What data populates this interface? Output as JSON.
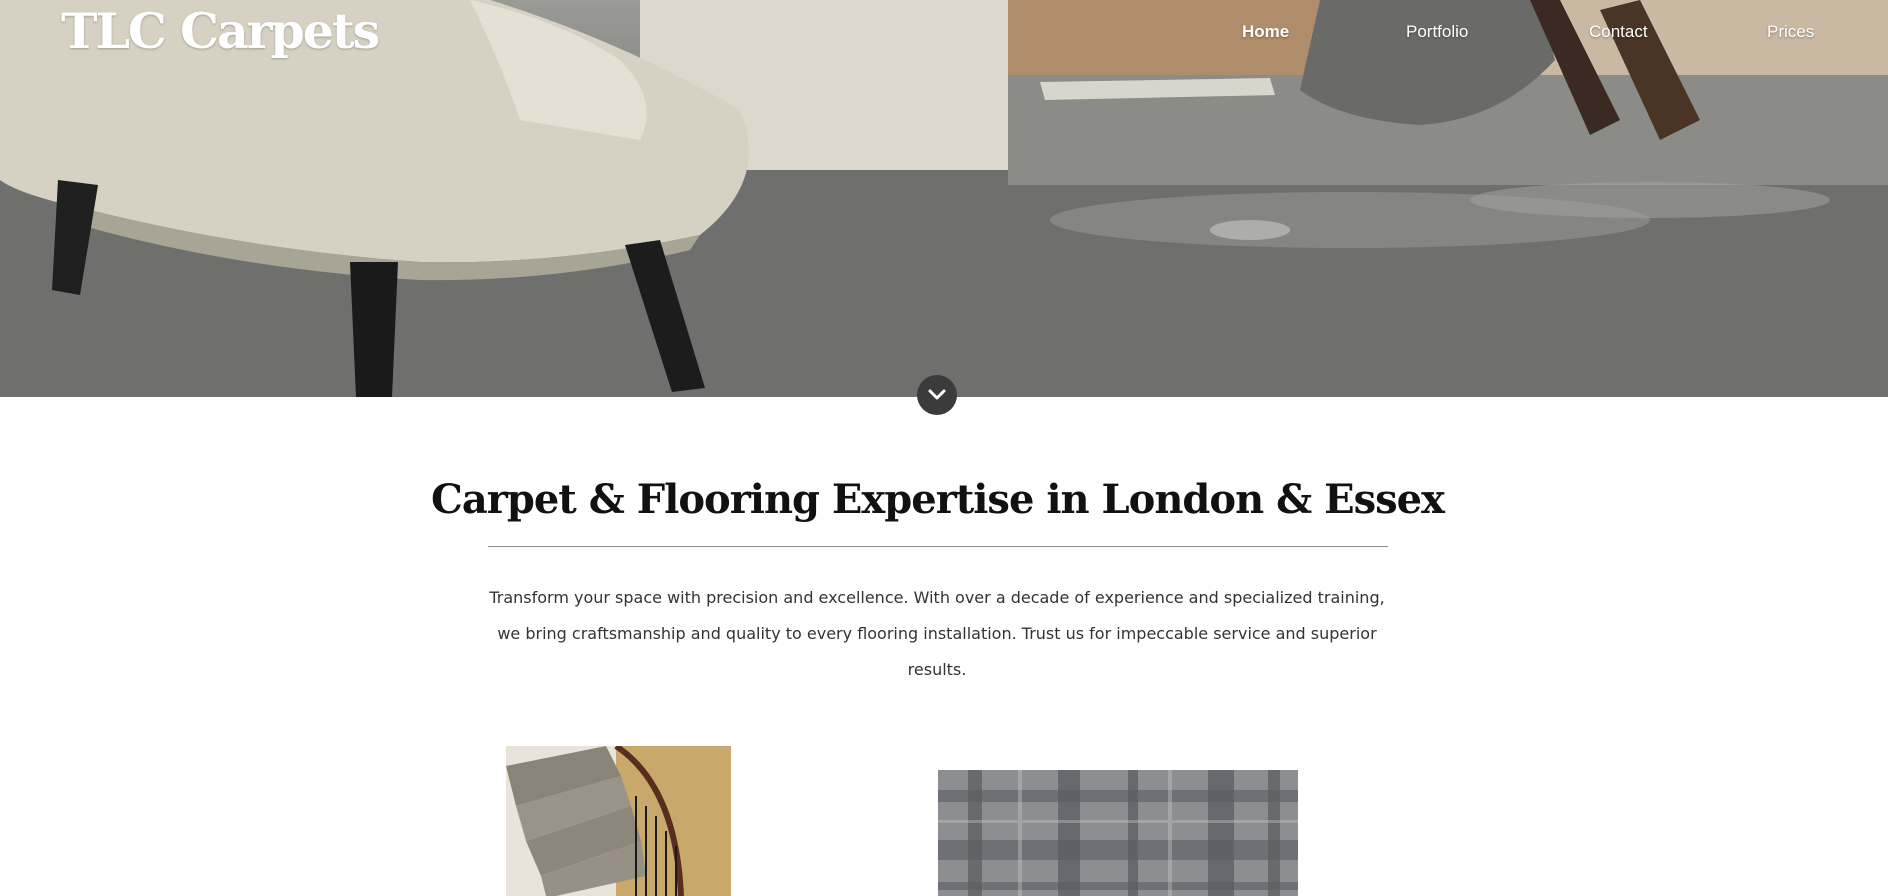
{
  "site": {
    "logo": "TLC Carpets"
  },
  "nav": {
    "items": [
      {
        "label": "Home",
        "active": true
      },
      {
        "label": "Portfolio",
        "active": false
      },
      {
        "label": "Contact",
        "active": false
      },
      {
        "label": "Prices",
        "active": false
      }
    ]
  },
  "hero": {
    "scroll_icon": "chevron-down-icon"
  },
  "intro": {
    "heading": "Carpet & Flooring Expertise in London & Essex",
    "body": "Transform your space with precision and excellence. With over a decade of experience and specialized training, we bring craftsmanship and quality to every flooring installation. Trust us for impeccable service and superior results."
  },
  "colors": {
    "background": "#ffffff",
    "heading": "#111111",
    "body_text": "#333333",
    "divider": "#8c8c8c",
    "scroll_button": "#3b3b3b"
  }
}
